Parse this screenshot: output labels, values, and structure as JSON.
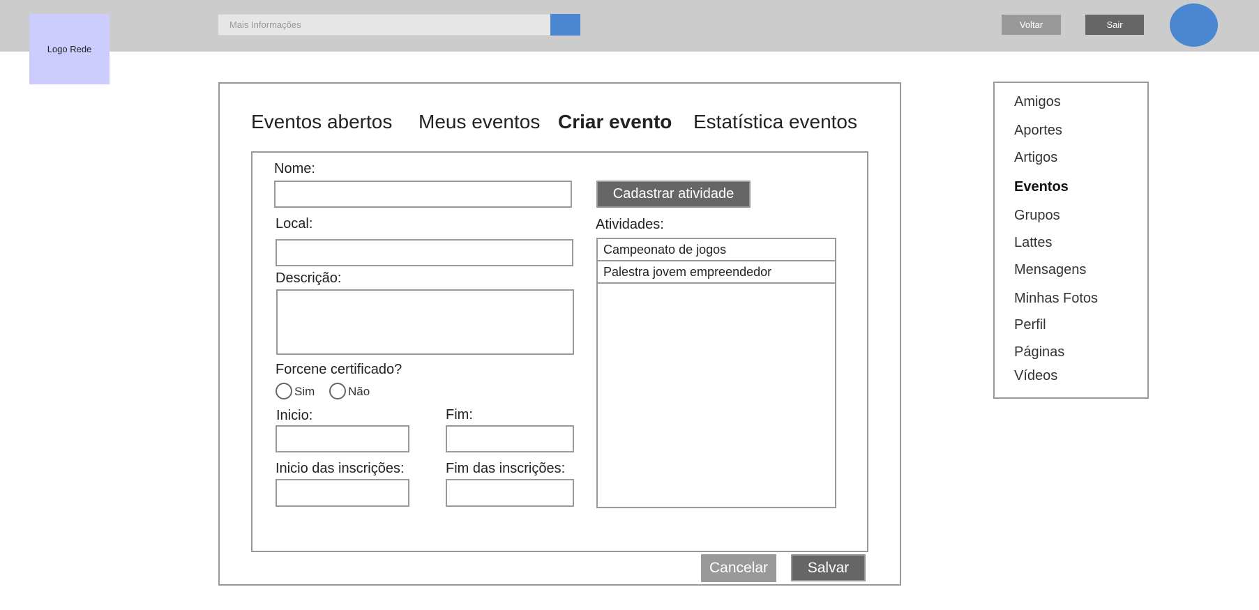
{
  "header": {
    "logo_text": "Logo Rede",
    "search_placeholder": "Mais Informações",
    "back_label": "Voltar",
    "exit_label": "Sair",
    "colors": {
      "bar": "#cccccc",
      "logo_bg": "#ccccff",
      "accent": "#4a87d0"
    }
  },
  "tabs": [
    {
      "label": "Eventos abertos",
      "active": false
    },
    {
      "label": "Meus eventos",
      "active": false
    },
    {
      "label": "Criar evento",
      "active": true
    },
    {
      "label": "Estatística eventos",
      "active": false
    }
  ],
  "form": {
    "name_label": "Nome:",
    "name_value": "",
    "location_label": "Local:",
    "location_value": "",
    "description_label": "Descrição:",
    "description_value": "",
    "certificate_label": "Forcene certificado?",
    "option_yes": "Sim",
    "option_no": "Não",
    "start_label": "Inicio:",
    "end_label": "Fim:",
    "registration_start_label": "Inicio das inscrições:",
    "registration_end_label": "Fim das inscrições:"
  },
  "activities": {
    "register_button": "Cadastrar atividade",
    "label": "Atividades:",
    "items": [
      "Campeonato de jogos",
      "Palestra jovem empreendedor"
    ]
  },
  "actions": {
    "cancel": "Cancelar",
    "save": "Salvar"
  },
  "sidebar": {
    "items": [
      {
        "label": "Amigos",
        "active": false
      },
      {
        "label": "Aportes",
        "active": false
      },
      {
        "label": "Artigos",
        "active": false
      },
      {
        "label": "Eventos",
        "active": true
      },
      {
        "label": "Grupos",
        "active": false
      },
      {
        "label": "Lattes",
        "active": false
      },
      {
        "label": "Mensagens",
        "active": false
      },
      {
        "label": "Minhas Fotos",
        "active": false
      },
      {
        "label": "Perfil",
        "active": false
      },
      {
        "label": "Páginas",
        "active": false
      },
      {
        "label": "Vídeos",
        "active": false
      }
    ]
  }
}
